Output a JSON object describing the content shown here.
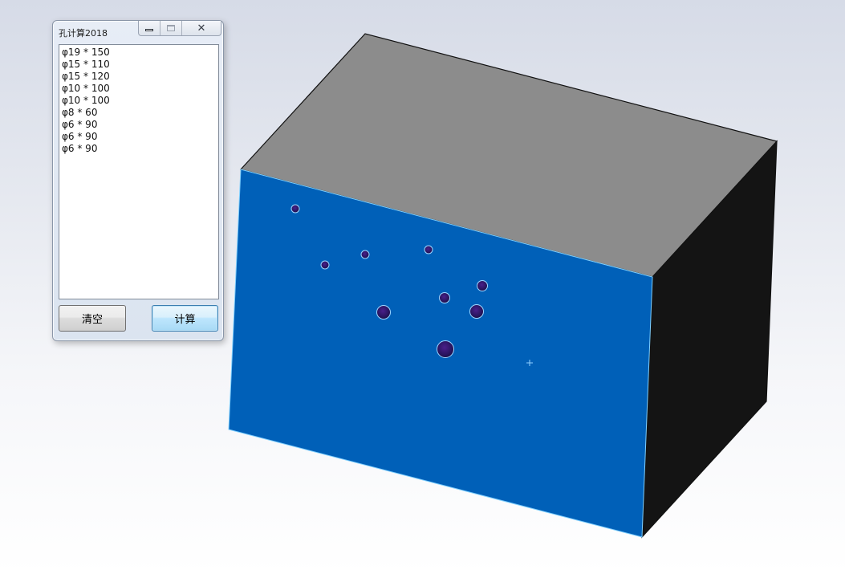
{
  "dialog": {
    "title": "孔计算2018",
    "close_symbol": "✕",
    "holes": [
      "φ19 * 150",
      "φ15 * 110",
      "φ15 * 120",
      "φ10 * 100",
      "φ10 * 100",
      "φ8 * 60",
      "φ6 * 90",
      "φ6 * 90",
      "φ6 * 90"
    ],
    "clear_label": "清空",
    "calc_label": "计算"
  },
  "viewport": {
    "face_colors": {
      "top": "#8c8c8c",
      "front": "#0060b8",
      "side": "#141414",
      "hole": "#2a1560",
      "edge_highlight": "#7fd0ff"
    }
  }
}
